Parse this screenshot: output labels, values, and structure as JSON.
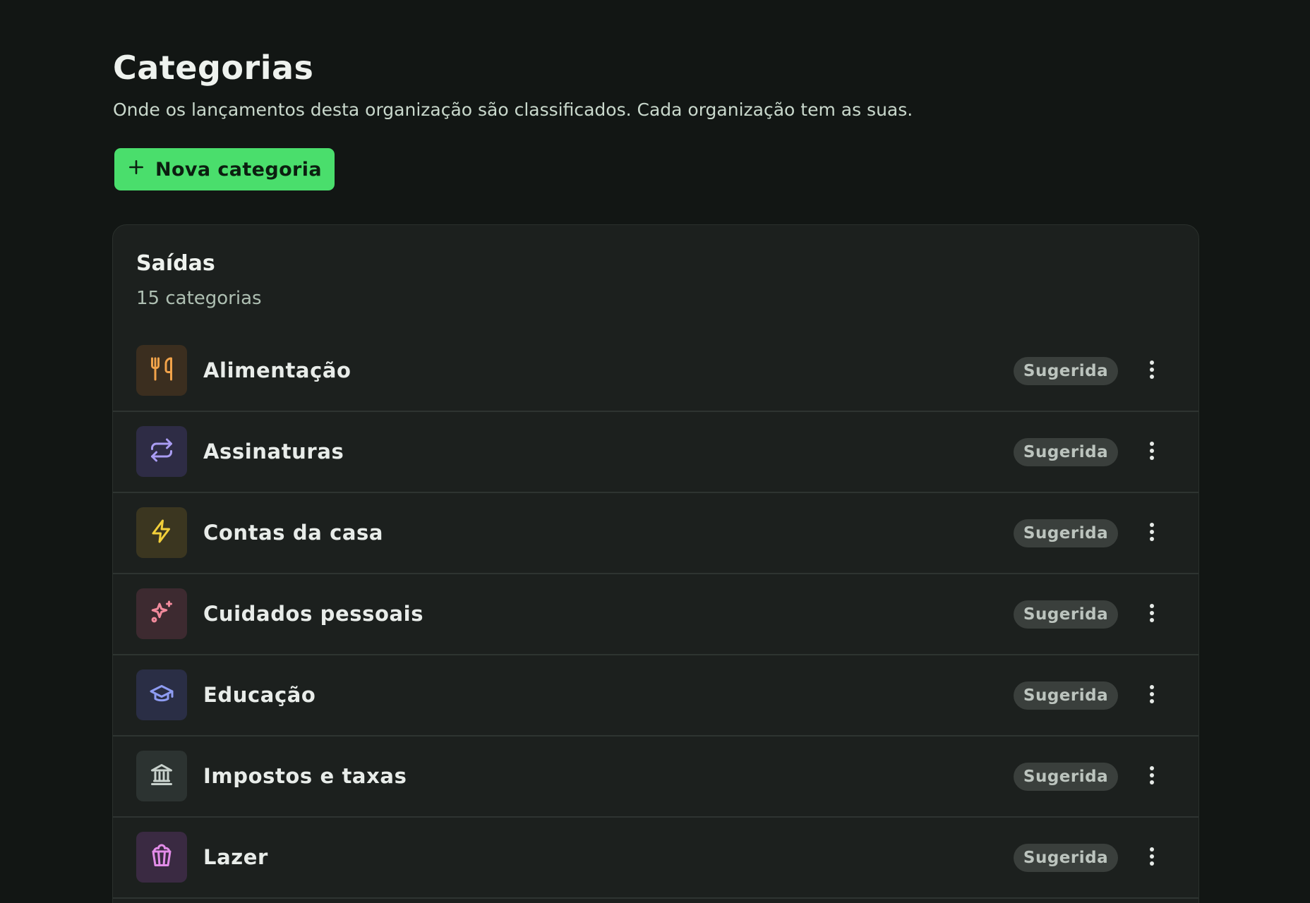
{
  "header": {
    "title": "Categorias",
    "subtitle": "Onde os lançamentos desta organização são classificados. Cada organização tem as suas.",
    "new_button_label": "Nova categoria"
  },
  "section": {
    "title": "Saídas",
    "count_label": "15 categorias",
    "items": [
      {
        "label": "Alimentação",
        "badge": "Sugerida",
        "icon": "utensils-icon",
        "tile_color": "#3b2e1f",
        "icon_color": "#f2a34a"
      },
      {
        "label": "Assinaturas",
        "badge": "Sugerida",
        "icon": "repeat-icon",
        "tile_color": "#2e2c45",
        "icon_color": "#a99cf2"
      },
      {
        "label": "Contas da casa",
        "badge": "Sugerida",
        "icon": "bolt-icon",
        "tile_color": "#3b3620",
        "icon_color": "#f2cf3a"
      },
      {
        "label": "Cuidados pessoais",
        "badge": "Sugerida",
        "icon": "sparkles-icon",
        "tile_color": "#3d2a30",
        "icon_color": "#f28a9c"
      },
      {
        "label": "Educação",
        "badge": "Sugerida",
        "icon": "graduation-cap-icon",
        "tile_color": "#2a2e45",
        "icon_color": "#8e9cf2"
      },
      {
        "label": "Impostos e taxas",
        "badge": "Sugerida",
        "icon": "landmark-icon",
        "tile_color": "#2c3331",
        "icon_color": "#c9d2cd"
      },
      {
        "label": "Lazer",
        "badge": "Sugerida",
        "icon": "popcorn-icon",
        "tile_color": "#3a2a42",
        "icon_color": "#e28ce8"
      }
    ]
  },
  "colors": {
    "background": "#121614",
    "panel": "#1c201e",
    "accent": "#4ade6c",
    "badge_bg": "#3a3f3c"
  }
}
